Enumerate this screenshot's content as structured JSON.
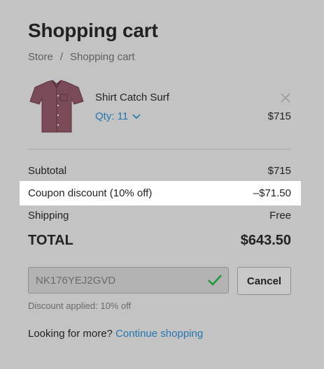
{
  "page": {
    "title": "Shopping cart"
  },
  "breadcrumb": {
    "items": [
      "Store",
      "Shopping cart"
    ],
    "separator": "/"
  },
  "cart_item": {
    "name": "Shirt Catch Surf",
    "qty_label": "Qty: 11",
    "price": "$715",
    "image_icon": "shirt-image",
    "remove_icon": "close-icon"
  },
  "summary": {
    "subtotal_label": "Subtotal",
    "subtotal_value": "$715",
    "coupon_label": "Coupon discount (10% off)",
    "coupon_value": "–$71.50",
    "shipping_label": "Shipping",
    "shipping_value": "Free",
    "total_label": "TOTAL",
    "total_value": "$643.50"
  },
  "coupon": {
    "code": "NK176YEJ2GVD",
    "status_icon": "checkmark-icon",
    "cancel_label": "Cancel",
    "note": "Discount applied: 10% off"
  },
  "footer": {
    "prompt": "Looking for more?",
    "link_label": "Continue shopping"
  },
  "colors": {
    "background": "#c3c3c3",
    "link": "#2476ae",
    "success": "#1f9a3a",
    "highlight": "#ffffff"
  }
}
